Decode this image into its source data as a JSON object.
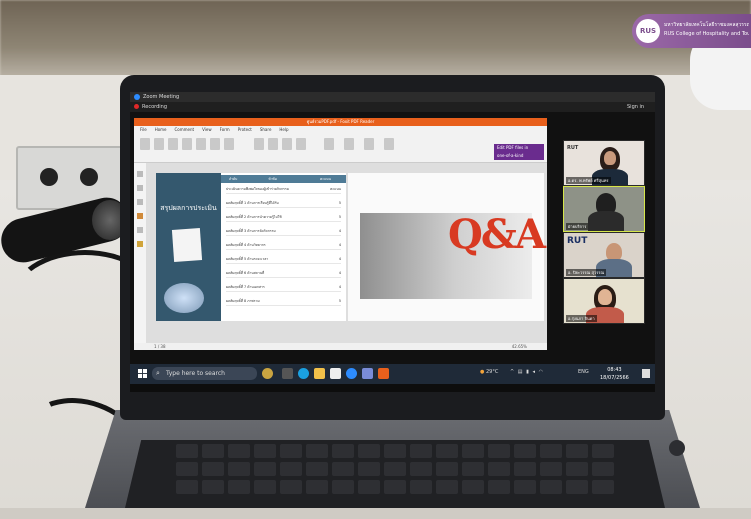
{
  "background_logo": {
    "line1": "มหาวิทยาลัยเทคโนโลยีราชมงคลสุวรรณภูมิ",
    "line2": "RUS College of Hospitality and Tourism",
    "mark": "RUS"
  },
  "zoom": {
    "window_title": "Zoom Meeting",
    "recording_label": "Recording",
    "sign_in": "Sign in"
  },
  "pdf_app": {
    "title": "ศูนย์รวมPDF.pdf - Foxit PDF Reader",
    "tabs": [
      "File",
      "Home",
      "Comment",
      "View",
      "Form",
      "Protect",
      "Share",
      "Help"
    ],
    "promo": [
      "Edit PDF files in",
      "one-of-a-kind"
    ],
    "zoom_level": "42.65%",
    "page_indicator": "1 / 38"
  },
  "slide": {
    "left_title": "สรุปผลการประเมิน",
    "table_header": [
      "ลำดับ",
      "หัวข้อ",
      "คะแนน"
    ],
    "rows": [
      [
        "ประเมินความพึงพอใจของผู้เข้าร่วมกิจกรรม",
        "คะแนน"
      ],
      [
        "ผลสัมฤทธิ์ที่ 1",
        "ด้านการเรียนรู้ที่ได้รับ",
        "5"
      ],
      [
        "ผลสัมฤทธิ์ที่ 2",
        "ด้านการนำความรู้ไปใช้",
        "5"
      ],
      [
        "ผลสัมฤทธิ์ที่ 3",
        "ด้านการจัดกิจกรรม",
        "4"
      ],
      [
        "ผลสัมฤทธิ์ที่ 4",
        "ด้านวิทยากร",
        "4"
      ],
      [
        "ผลสัมฤทธิ์ที่ 5",
        "ด้านระยะเวลา",
        "4"
      ],
      [
        "ผลสัมฤทธิ์ที่ 6",
        "ด้านสถานที่",
        "4"
      ],
      [
        "ผลสัมฤทธิ์ที่ 7",
        "ด้านเอกสาร",
        "4"
      ],
      [
        "ผลสัมฤทธิ์ที่ 8",
        "ภาพรวม",
        "5"
      ]
    ],
    "qa_text": "Q&A"
  },
  "participants": [
    {
      "name": "อ.ดร. พ.ทรัพย์ ศรีสุนทร",
      "logo": "RUT"
    },
    {
      "name": "ฝ่ายบริการ",
      "logo": ""
    },
    {
      "name": "อ. ปิยะวรรณ สุวรรณ",
      "logo": "RUT"
    },
    {
      "name": "อ.รุ่งนภา จินดา",
      "logo": ""
    }
  ],
  "taskbar": {
    "search_placeholder": "Type here to search",
    "weather": "29°C",
    "lang": "ENG",
    "time": "08:43",
    "date": "18/07/2566"
  }
}
